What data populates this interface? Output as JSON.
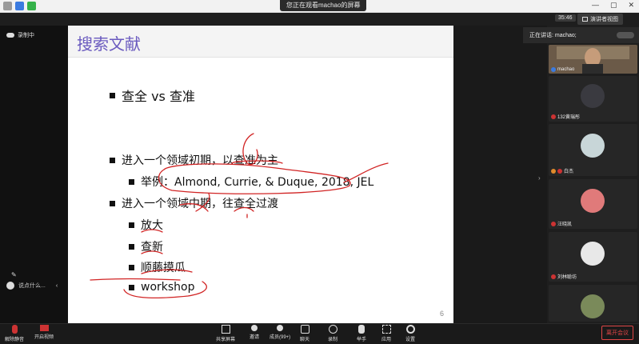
{
  "window": {
    "view_banner": "您正在观看machao的屏幕",
    "controls": [
      "—",
      "▢",
      "✕"
    ]
  },
  "meeting": {
    "timer": "35:46",
    "view_mode": "演讲者视图",
    "recording_label": "录制中",
    "chat_placeholder": "说点什么...",
    "speaking_label": "正在讲话: machao;"
  },
  "slide": {
    "title": "搜索文献",
    "bullet1": "查全 vs 查准",
    "bullet2": "进入一个领域初期，以查准为主",
    "bullet2_sub": "举例：Almond, Currie, & Duque, 2018, JEL",
    "bullet3": "进入一个领域中期，往查全过渡",
    "sub_items": [
      "放大",
      "查新",
      "顺藤摸瓜",
      "workshop"
    ],
    "page_number": "6",
    "accent_color": "#6a5abf"
  },
  "participants": [
    {
      "name": "machao",
      "kind": "video"
    },
    {
      "name": "132黄瑞彤",
      "kind": "avatar"
    },
    {
      "name": "白杰",
      "kind": "avatar"
    },
    {
      "name": "汪晓凯",
      "kind": "avatar"
    },
    {
      "name": "刘林聪坊",
      "kind": "avatar"
    },
    {
      "name": "",
      "kind": "avatar"
    }
  ],
  "toolbar": {
    "mute": "解除静音",
    "video": "开启视频",
    "share": "共享屏幕",
    "invite": "邀请",
    "members": "成员(99+)",
    "chat": "聊天",
    "record": "录制",
    "reactions": "举手",
    "apps": "应用",
    "settings": "设置",
    "leave": "离开会议"
  }
}
